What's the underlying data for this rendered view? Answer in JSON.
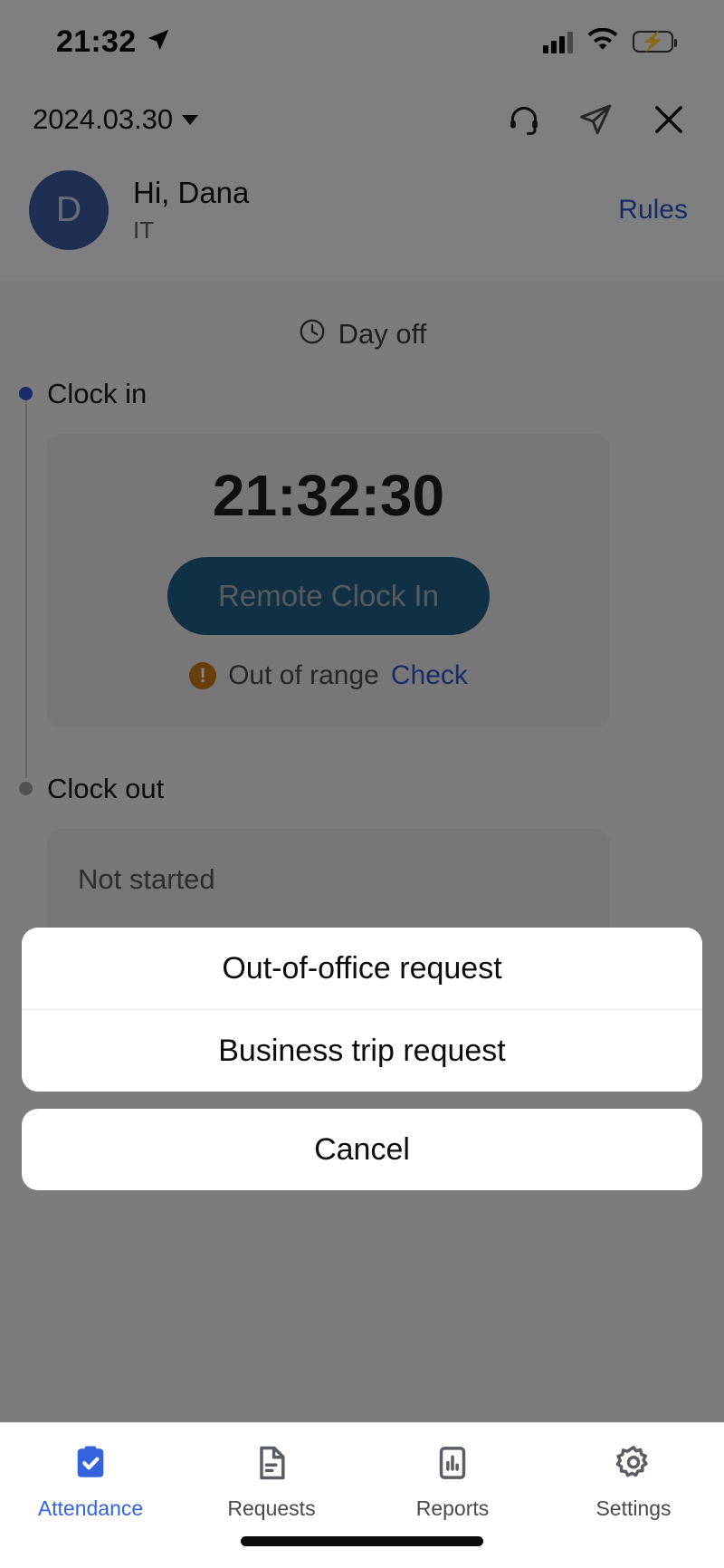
{
  "status_bar": {
    "time": "21:32",
    "location_icon": "location-arrow-icon",
    "signal_icon": "cellular-signal-icon",
    "wifi_icon": "wifi-icon",
    "battery_icon": "battery-charging-icon"
  },
  "topbar": {
    "date": "2024.03.30",
    "caret_icon": "chevron-down-icon",
    "support_icon": "headset-icon",
    "share_icon": "send-icon",
    "close_icon": "close-icon"
  },
  "profile": {
    "avatar_initial": "D",
    "greeting": "Hi, Dana",
    "department": "IT",
    "rules_label": "Rules"
  },
  "attendance": {
    "day_status": "Day off",
    "day_status_icon": "clock-icon",
    "clock_in": {
      "label": "Clock in",
      "timer": "21:32:30",
      "button_label": "Remote Clock In",
      "warning_icon": "exclamation-circle-icon",
      "warning_text": "Out of range",
      "check_label": "Check"
    },
    "clock_out": {
      "label": "Clock out",
      "status": "Not started"
    }
  },
  "action_sheet": {
    "options": [
      {
        "label": "Out-of-office request"
      },
      {
        "label": "Business trip request"
      }
    ],
    "cancel_label": "Cancel"
  },
  "tabbar": {
    "tabs": [
      {
        "label": "Attendance",
        "icon": "clipboard-check-icon",
        "active": true
      },
      {
        "label": "Requests",
        "icon": "document-icon",
        "active": false
      },
      {
        "label": "Reports",
        "icon": "bar-chart-icon",
        "active": false
      },
      {
        "label": "Settings",
        "icon": "gear-icon",
        "active": false
      }
    ]
  },
  "colors": {
    "accent_blue": "#3563dd",
    "link_blue": "#2b55c4",
    "avatar_blue": "#3d5a9e",
    "clock_button": "#1f5d82",
    "warning_orange": "#c4791a",
    "battery_green": "#6cdb6c"
  }
}
